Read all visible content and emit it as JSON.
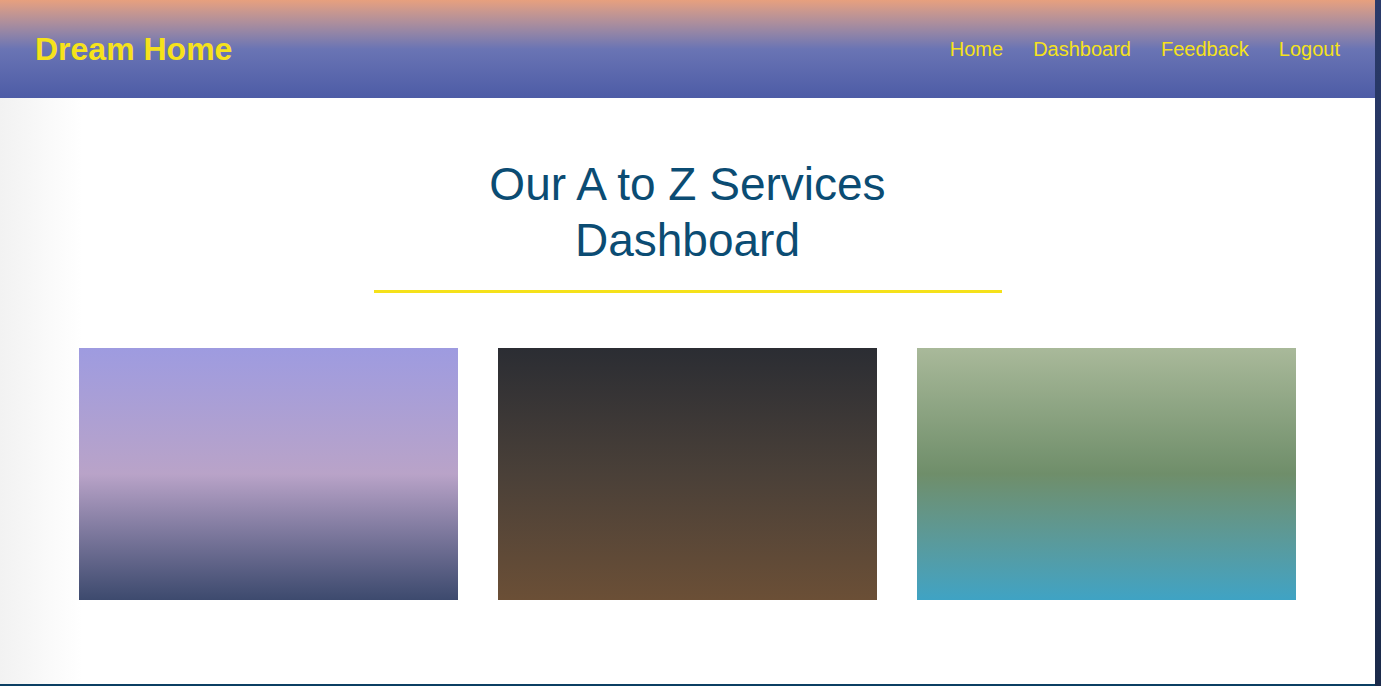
{
  "header": {
    "logo": "Dream Home",
    "nav": [
      {
        "label": "Home"
      },
      {
        "label": "Dashboard"
      },
      {
        "label": "Feedback"
      },
      {
        "label": "Logout"
      }
    ]
  },
  "heading": {
    "lines": [
      "Our A to Z Services",
      "Dashboard"
    ]
  }
}
